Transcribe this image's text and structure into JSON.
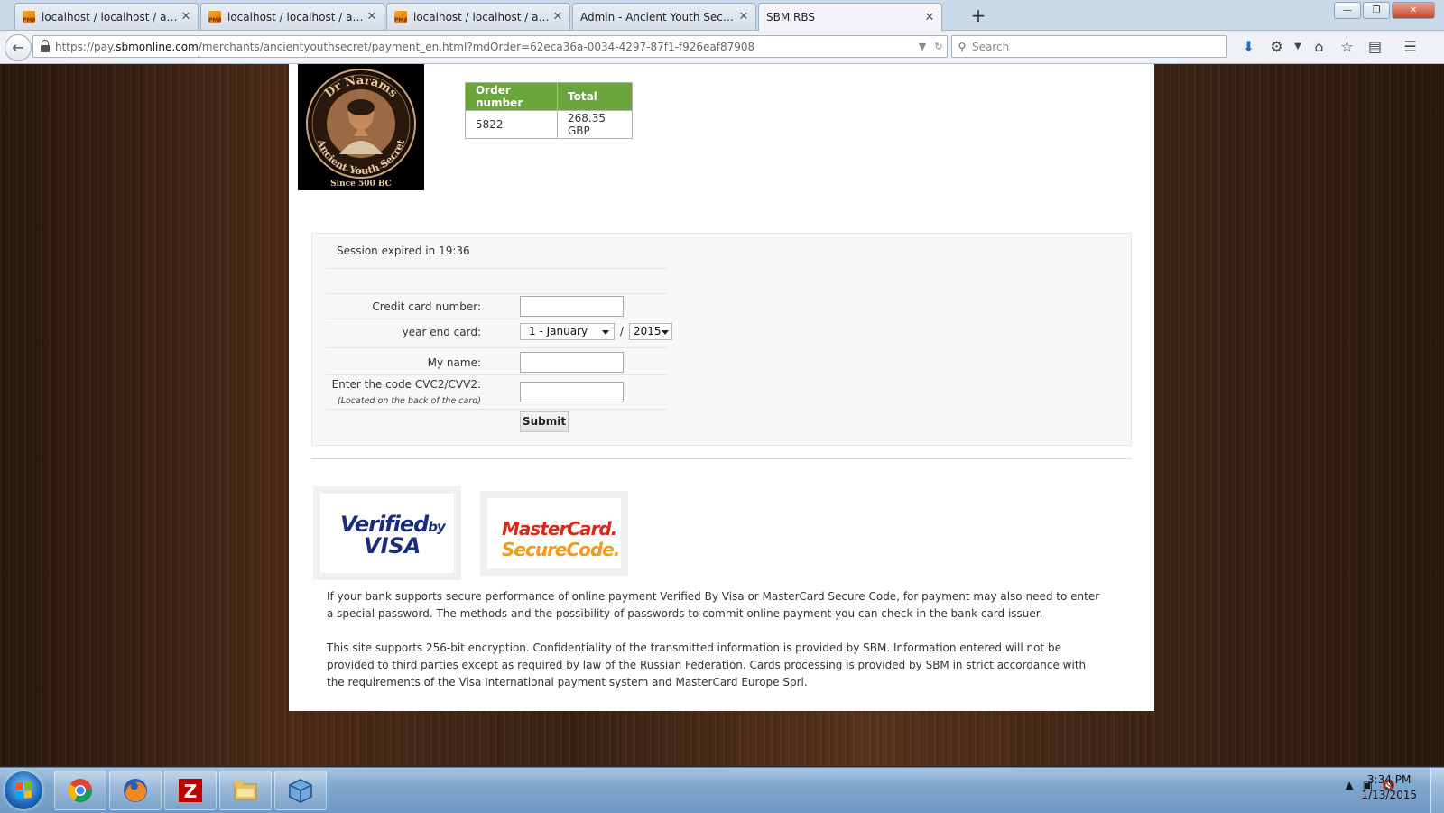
{
  "browser": {
    "tabs": [
      {
        "label": "localhost / localhost / ays_...",
        "favicon": "phpmyadmin-icon",
        "active": false
      },
      {
        "label": "localhost / localhost / ays_...",
        "favicon": "phpmyadmin-icon",
        "active": false
      },
      {
        "label": "localhost / localhost / ays_...",
        "favicon": "phpmyadmin-icon",
        "active": false
      },
      {
        "label": "Admin - Ancient Youth Secrets",
        "favicon": "none",
        "active": false
      },
      {
        "label": "SBM RBS",
        "favicon": "none",
        "active": true
      }
    ],
    "favicon_text": "PMA",
    "close_glyph": "✕",
    "new_tab_glyph": "+",
    "url_prefix": "https://pay.",
    "url_host": "sbmonline.com",
    "url_rest": "/merchants/ancientyouthsecret/payment_en.html?mdOrder=62eca36a-0034-4297-87f1-f926eaf87908",
    "search_placeholder": "Search"
  },
  "logo": {
    "top_text": "Dr Narams",
    "bottom_text": "Ancient Youth Secret",
    "since_text": "Since 500 BC"
  },
  "order": {
    "headers": {
      "order_number": "Order number",
      "total": "Total"
    },
    "order_number": "5822",
    "total": "268.35 GBP"
  },
  "form": {
    "session_text": "Session expired in 19:36",
    "card_number_label": "Credit card number:",
    "expiry_label": "year end card:",
    "month_value": "1 - January",
    "year_value": "2015",
    "separator": "/",
    "name_label": "My name:",
    "cvc_label": "Enter the code CVC2/CVV2:",
    "cvc_hint": "(Located on the back of the card)",
    "submit_label": "Submit"
  },
  "badges": {
    "visa_line1": "Verified",
    "visa_by": "by",
    "visa_line2": "VISA",
    "mc_line1": "MasterCard.",
    "mc_line2": "SecureCode."
  },
  "info": {
    "p1": "If your bank supports secure performance of online payment Verified By Visa or MasterCard Secure Code, for payment may also need to enter a special password. The methods and the possibility of passwords to commit online payment you can check in the bank card issuer.",
    "p2": "This site supports 256-bit encryption. Confidentiality of the transmitted information is provided by SBM. Information entered will not be provided to third parties except as required by law of the Russian Federation. Cards processing is provided by SBM in strict accordance with the requirements of the Visa International payment system and MasterCard Europe Sprl."
  },
  "taskbar": {
    "apps": [
      "chrome-icon",
      "firefox-icon",
      "filezilla-icon",
      "file-explorer-icon",
      "virtualbox-icon"
    ],
    "time": "3:34 PM",
    "date": "1/13/2015"
  },
  "colors": {
    "table_header": "#6aa63b",
    "visa_blue": "#1a2d7a",
    "mc_red": "#d42b1e",
    "mc_orange": "#f39a19"
  }
}
